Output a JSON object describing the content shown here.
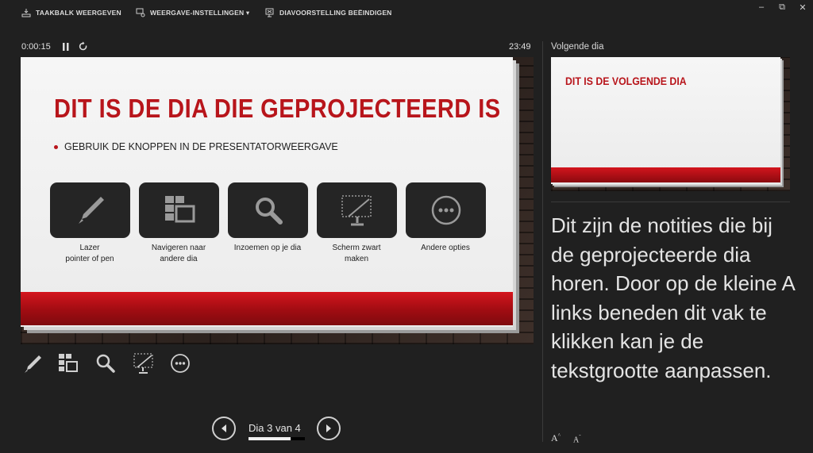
{
  "topbar": {
    "show_taskbar": "TAAKBALK WEERGEVEN",
    "display_settings": "WEERGAVE-INSTELLINGEN ▾",
    "end_slideshow": "DIAVOORSTELLING BEËINDIGEN",
    "minimize": "–",
    "restore": "⧉",
    "close": "✕"
  },
  "timer": {
    "elapsed": "0:00:15",
    "clock": "23:49"
  },
  "current_slide": {
    "title": "DIT IS DE DIA DIE GEPROJECTEERD IS",
    "bullet": "GEBRUIK DE KNOPPEN IN DE PRESENTATORWEERGAVE",
    "tiles": [
      {
        "icon": "pen-icon",
        "label": "Lazer\npointer of pen"
      },
      {
        "icon": "grid-icon",
        "label": "Navigeren naar\nandere dia"
      },
      {
        "icon": "magnifier-icon",
        "label": "Inzoemen op je dia"
      },
      {
        "icon": "black-screen-icon",
        "label": "Scherm zwart\nmaken"
      },
      {
        "icon": "more-icon",
        "label": "Andere opties"
      }
    ]
  },
  "navigation": {
    "counter": "Dia 3 van 4",
    "progress": 0.75
  },
  "next_slide": {
    "label": "Volgende dia",
    "title": "DIT IS DE VOLGENDE DIA"
  },
  "notes": {
    "text": "Dit zijn de notities die bij de geprojecteerde dia horen. Door op de kleine A links beneden dit vak te klikken kan je de tekstgrootte aanpassen."
  },
  "font_controls": {
    "increase": "A",
    "decrease": "A"
  },
  "colors": {
    "accent_red": "#b8151b",
    "background": "#202020"
  }
}
